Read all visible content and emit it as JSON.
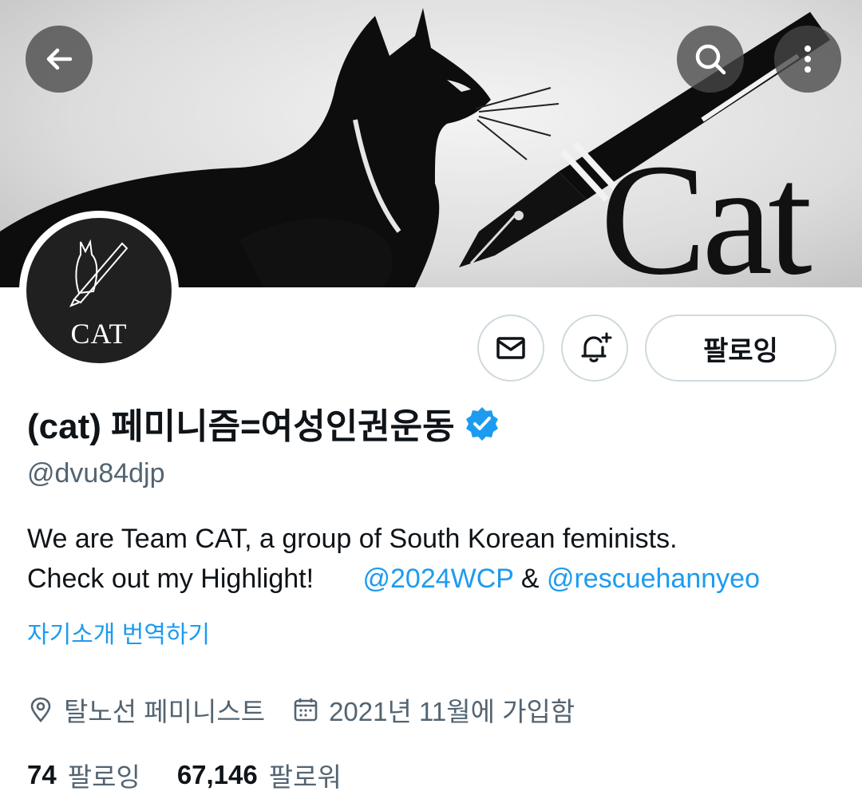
{
  "header": {
    "back_icon": "arrow-left-icon",
    "search_icon": "search-icon",
    "more_icon": "more-vertical-icon"
  },
  "banner": {
    "word": "Cat"
  },
  "avatar": {
    "text": "CAT"
  },
  "actions": {
    "message_icon": "mail-icon",
    "notify_icon": "bell-plus-icon",
    "follow_label": "팔로잉"
  },
  "profile": {
    "display_name": "(cat) 페미니즘=여성인권운동",
    "verified_icon": "verified-badge-icon",
    "handle": "@dvu84djp",
    "bio_line1": "We are Team CAT, a group of South Korean feminists.",
    "bio_line2_prefix": "Check out my Highlight!",
    "bio_mention1": "@2024WCP",
    "bio_amp": "&",
    "bio_mention2": "@rescuehannyeo",
    "translate_label": "자기소개 번역하기",
    "location": "탈노선 페미니스트",
    "location_icon": "location-pin-icon",
    "joined": "2021년 11월에 가입함",
    "joined_icon": "calendar-icon",
    "following_count": "74",
    "following_label": "팔로잉",
    "followers_count": "67,146",
    "followers_label": "팔로워"
  },
  "colors": {
    "accent": "#1d9bf0",
    "secondary_text": "#536471",
    "primary_text": "#0f1419",
    "border": "#cfd9de"
  }
}
